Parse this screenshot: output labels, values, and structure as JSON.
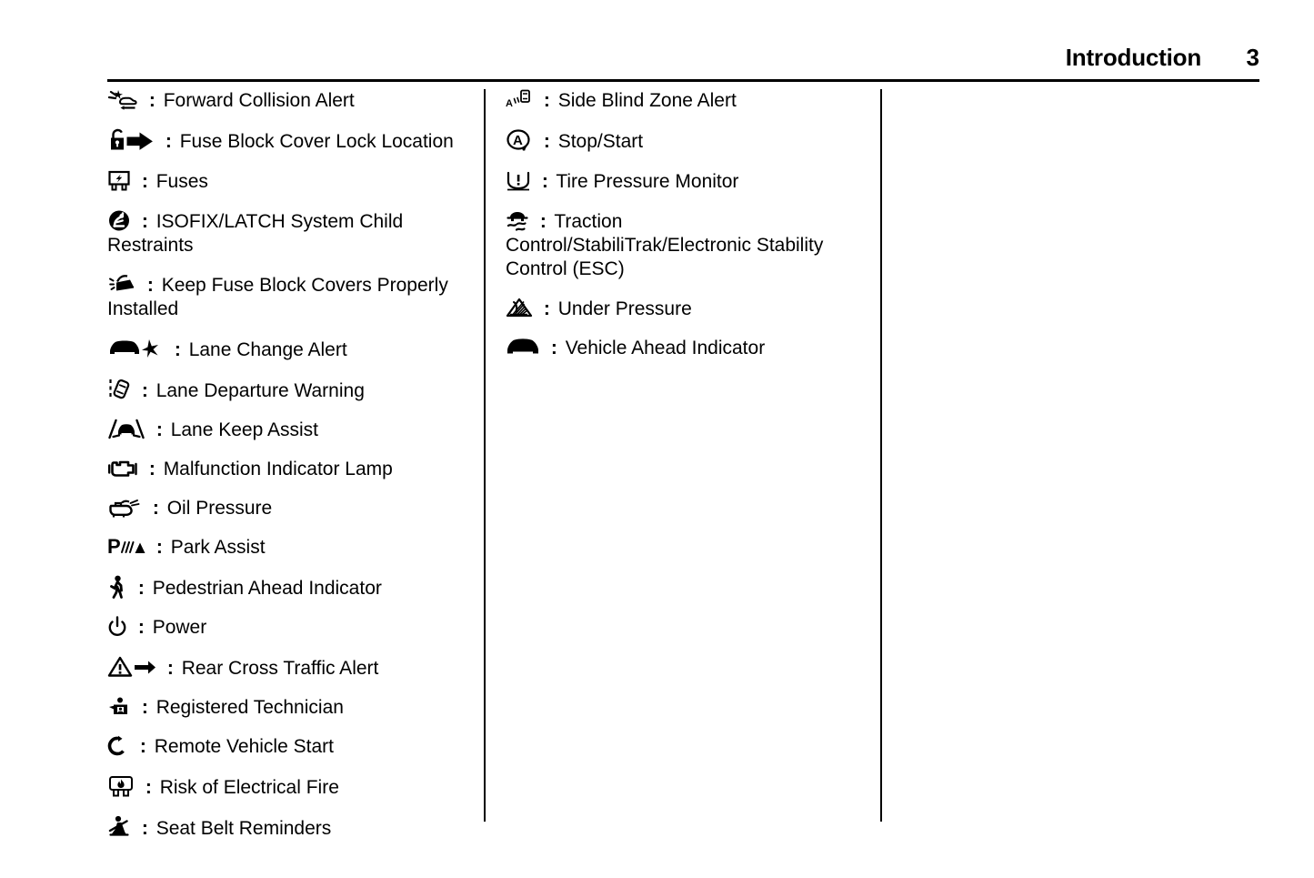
{
  "header": {
    "chapter_title": "Introduction",
    "page_number": "3"
  },
  "separator": ":",
  "columns": {
    "left": [
      {
        "icon": "forward-collision-alert-icon",
        "label": "Forward Collision Alert"
      },
      {
        "icon": "fuse-block-cover-lock-location-icon",
        "label": "Fuse Block Cover Lock Location"
      },
      {
        "icon": "fuses-icon",
        "label": "Fuses"
      },
      {
        "icon": "isofix-latch-child-restraint-icon",
        "label": "ISOFIX/LATCH System Child Restraints"
      },
      {
        "icon": "keep-fuse-block-covers-installed-icon",
        "label": "Keep Fuse Block Covers Properly Installed"
      },
      {
        "icon": "lane-change-alert-icon",
        "label": "Lane Change Alert"
      },
      {
        "icon": "lane-departure-warning-icon",
        "label": "Lane Departure Warning"
      },
      {
        "icon": "lane-keep-assist-icon",
        "label": "Lane Keep Assist"
      },
      {
        "icon": "malfunction-indicator-lamp-icon",
        "label": "Malfunction Indicator Lamp"
      },
      {
        "icon": "oil-pressure-icon",
        "label": "Oil Pressure"
      },
      {
        "icon": "park-assist-icon",
        "label": "Park Assist"
      },
      {
        "icon": "pedestrian-ahead-indicator-icon",
        "label": "Pedestrian Ahead Indicator"
      },
      {
        "icon": "power-icon",
        "label": "Power"
      },
      {
        "icon": "rear-cross-traffic-alert-icon",
        "label": "Rear Cross Traffic Alert"
      },
      {
        "icon": "registered-technician-icon",
        "label": "Registered Technician"
      },
      {
        "icon": "remote-vehicle-start-icon",
        "label": "Remote Vehicle Start"
      },
      {
        "icon": "risk-of-electrical-fire-icon",
        "label": "Risk of Electrical Fire"
      },
      {
        "icon": "seat-belt-reminders-icon",
        "label": "Seat Belt Reminders"
      }
    ],
    "middle": [
      {
        "icon": "side-blind-zone-alert-icon",
        "label": "Side Blind Zone Alert"
      },
      {
        "icon": "stop-start-icon",
        "label": "Stop/Start"
      },
      {
        "icon": "tire-pressure-monitor-icon",
        "label": "Tire Pressure Monitor"
      },
      {
        "icon": "traction-control-icon",
        "label": "Traction Control/StabiliTrak/Electronic Stability Control (ESC)"
      },
      {
        "icon": "under-pressure-icon",
        "label": "Under Pressure"
      },
      {
        "icon": "vehicle-ahead-indicator-icon",
        "label": "Vehicle Ahead Indicator"
      }
    ],
    "right": []
  },
  "colors": {
    "ink": "#000000",
    "paper": "#ffffff"
  }
}
